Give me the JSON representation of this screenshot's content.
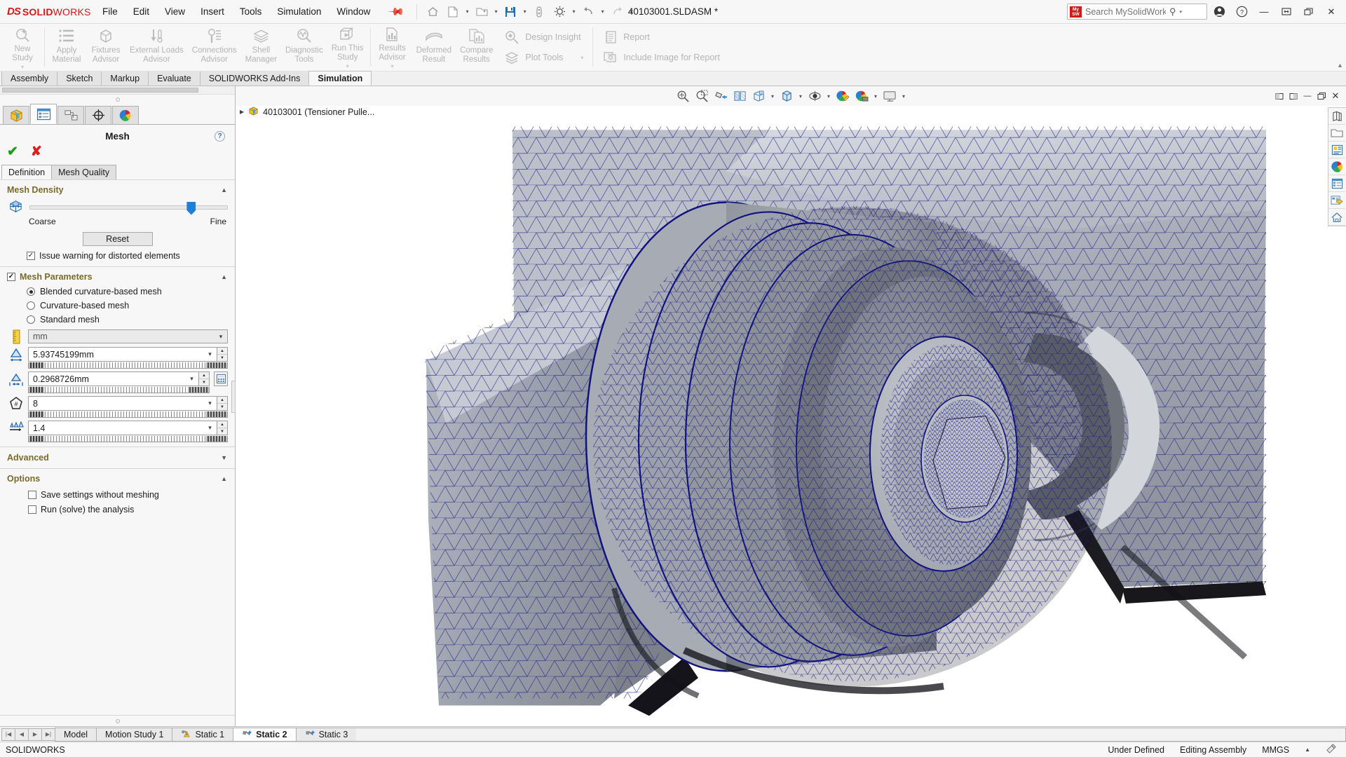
{
  "titlebar": {
    "brand_ds": "2S",
    "brand_name": "SOLID",
    "brand_name_alt": "WORKS",
    "menus": [
      "File",
      "Edit",
      "View",
      "Insert",
      "Tools",
      "Simulation",
      "Window"
    ],
    "pin_icon": "pin-icon",
    "document_title": "40103001.SLDASM *",
    "quick_access": [
      {
        "name": "home-icon",
        "glyph": "home"
      },
      {
        "name": "new-document-icon",
        "glyph": "doc"
      },
      {
        "name": "open-document-icon",
        "glyph": "open"
      },
      {
        "name": "save-icon",
        "glyph": "save"
      },
      {
        "name": "print-icon",
        "glyph": "print"
      },
      {
        "name": "options-gear-icon",
        "glyph": "gear"
      },
      {
        "name": "undo-icon",
        "glyph": "undo"
      },
      {
        "name": "redo-icon",
        "glyph": "redo"
      }
    ],
    "search": {
      "placeholder": "Search MySolidWorks",
      "value": "",
      "badge_top": "My",
      "badge_bottom": "SW"
    },
    "account_icon": "account-icon",
    "help_icon": "help-icon",
    "window_buttons": [
      {
        "name": "minimize-button",
        "glyph": "—"
      },
      {
        "name": "restore-button",
        "glyph": "▣"
      },
      {
        "name": "maximize-button",
        "glyph": "❐"
      },
      {
        "name": "close-button",
        "glyph": "✕"
      }
    ]
  },
  "ribbon": {
    "commands": [
      {
        "label": "New\nStudy",
        "icon": "new-study-icon",
        "dropdown": true
      },
      {
        "label": "Apply\nMaterial",
        "icon": "apply-material-icon",
        "dropdown": false
      },
      {
        "label": "Fixtures\nAdvisor",
        "icon": "fixtures-advisor-icon",
        "dropdown": false
      },
      {
        "label": "External Loads\nAdvisor",
        "icon": "external-loads-advisor-icon",
        "dropdown": false
      },
      {
        "label": "Connections\nAdvisor",
        "icon": "connections-advisor-icon",
        "dropdown": false
      },
      {
        "label": "Shell\nManager",
        "icon": "shell-manager-icon",
        "dropdown": false
      },
      {
        "label": "Diagnostic\nTools",
        "icon": "diagnostic-tools-icon",
        "dropdown": false
      },
      {
        "label": "Run This\nStudy",
        "icon": "run-this-study-icon",
        "dropdown": true
      },
      {
        "label": "Results\nAdvisor",
        "icon": "results-advisor-icon",
        "dropdown": true
      },
      {
        "label": "Deformed\nResult",
        "icon": "deformed-result-icon",
        "dropdown": false
      },
      {
        "label": "Compare\nResults",
        "icon": "compare-results-icon",
        "dropdown": false
      }
    ],
    "stack_a": [
      {
        "label": "Design Insight",
        "icon": "design-insight-icon",
        "dropdown": false
      },
      {
        "label": "Plot Tools",
        "icon": "plot-tools-icon",
        "dropdown": true
      }
    ],
    "stack_b": [
      {
        "label": "Report",
        "icon": "report-icon",
        "dropdown": false
      },
      {
        "label": "Include Image for Report",
        "icon": "include-image-icon",
        "dropdown": false
      }
    ],
    "collapse_icon": "collapse-ribbon-icon"
  },
  "command_tabs": {
    "tabs": [
      "Assembly",
      "Sketch",
      "Markup",
      "Evaluate",
      "SOLIDWORKS Add-Ins",
      "Simulation"
    ],
    "active": "Simulation"
  },
  "property_manager": {
    "tabs": [
      {
        "name": "feature-manager-tab",
        "icon": "feature-tree-icon",
        "active": false
      },
      {
        "name": "property-manager-tab",
        "icon": "property-manager-icon",
        "active": true
      },
      {
        "name": "configuration-manager-tab",
        "icon": "configuration-manager-icon",
        "active": false
      },
      {
        "name": "dimxpert-manager-tab",
        "icon": "dimxpert-icon",
        "active": false
      },
      {
        "name": "display-manager-tab",
        "icon": "display-manager-icon",
        "active": false
      }
    ],
    "title": "Mesh",
    "help_glyph": "?",
    "ok_glyph": "✔",
    "cancel_glyph": "✘",
    "sub_tabs": [
      "Definition",
      "Mesh Quality"
    ],
    "sub_tab_active": "Definition",
    "mesh_density": {
      "header": "Mesh Density",
      "icon": "mesh-density-icon",
      "slider_value": 82,
      "label_coarse": "Coarse",
      "label_fine": "Fine",
      "reset_label": "Reset",
      "warning_checkbox": {
        "label": "Issue warning for distorted elements",
        "checked": true
      }
    },
    "mesh_parameters": {
      "header": "Mesh Parameters",
      "header_checked": true,
      "options": [
        {
          "label": "Blended curvature-based mesh",
          "selected": true
        },
        {
          "label": "Curvature-based mesh",
          "selected": false
        },
        {
          "label": "Standard mesh",
          "selected": false
        }
      ],
      "units": {
        "icon": "ruler-icon",
        "value": "mm"
      },
      "max_element_size": {
        "icon": "max-element-size-icon",
        "value": "5.93745199mm"
      },
      "min_element_size": {
        "icon": "min-element-size-icon",
        "value": "0.2968726mm"
      },
      "min_elements_in_circle": {
        "icon": "circle-elements-icon",
        "value": "8"
      },
      "element_size_growth_ratio": {
        "icon": "growth-ratio-icon",
        "value": "1.4"
      },
      "calculator_icon": "mesh-calculator-icon"
    },
    "advanced": {
      "header": "Advanced"
    },
    "options": {
      "header": "Options",
      "items": [
        {
          "label": "Save settings without meshing",
          "checked": false
        },
        {
          "label": "Run (solve) the analysis",
          "checked": false
        }
      ]
    }
  },
  "graphics": {
    "view_toolbar": [
      {
        "name": "zoom-to-fit-icon",
        "dropdown": false
      },
      {
        "name": "zoom-to-area-icon",
        "dropdown": false
      },
      {
        "name": "previous-view-icon",
        "dropdown": false
      },
      {
        "name": "section-view-icon",
        "dropdown": false
      },
      {
        "name": "view-orientation-icon",
        "dropdown": true
      },
      {
        "name": "display-style-icon",
        "dropdown": true
      },
      {
        "name": "hide-show-items-icon",
        "dropdown": true
      },
      {
        "name": "edit-appearance-icon",
        "dropdown": false
      },
      {
        "name": "apply-scene-icon",
        "dropdown": true
      },
      {
        "name": "view-settings-icon",
        "dropdown": true
      }
    ],
    "window_buttons": [
      {
        "name": "restore-doc-button",
        "glyph": "◨"
      },
      {
        "name": "collapse-doc-button",
        "glyph": "◧"
      },
      {
        "name": "minimize-doc-button",
        "glyph": "—"
      },
      {
        "name": "maximize-doc-button",
        "glyph": "❐"
      },
      {
        "name": "close-doc-button",
        "glyph": "✕"
      }
    ],
    "tree_root": {
      "expand_glyph": "▶",
      "icon": "assembly-icon",
      "label": "40103001 (Tensioner Pulle..."
    },
    "right_toolbar": [
      {
        "name": "display-pane-icon"
      },
      {
        "name": "open-folder-icon"
      },
      {
        "name": "hide-show-tree-icon"
      },
      {
        "name": "appearances-icon"
      },
      {
        "name": "display-manager-right-icon"
      },
      {
        "name": "task-pane-icon"
      },
      {
        "name": "home-pane-icon"
      }
    ]
  },
  "bottom_tabs": {
    "nav": [
      "|◀",
      "◀",
      "▶",
      "▶|"
    ],
    "tabs": [
      {
        "label": "Model",
        "icon": null,
        "active": false
      },
      {
        "label": "Motion Study 1",
        "icon": null,
        "active": false
      },
      {
        "label": "Static 1",
        "icon": "study-warning-icon",
        "active": false
      },
      {
        "label": "Static 2",
        "icon": "study-icon",
        "active": true
      },
      {
        "label": "Static 3",
        "icon": "study-icon",
        "active": false
      }
    ]
  },
  "statusbar": {
    "left": "SOLIDWORKS",
    "sketch_state": "Under Defined",
    "edit_mode": "Editing Assembly",
    "units": "MMGS",
    "units_carat": "▲",
    "overlay_icon": "units-settings-icon"
  }
}
